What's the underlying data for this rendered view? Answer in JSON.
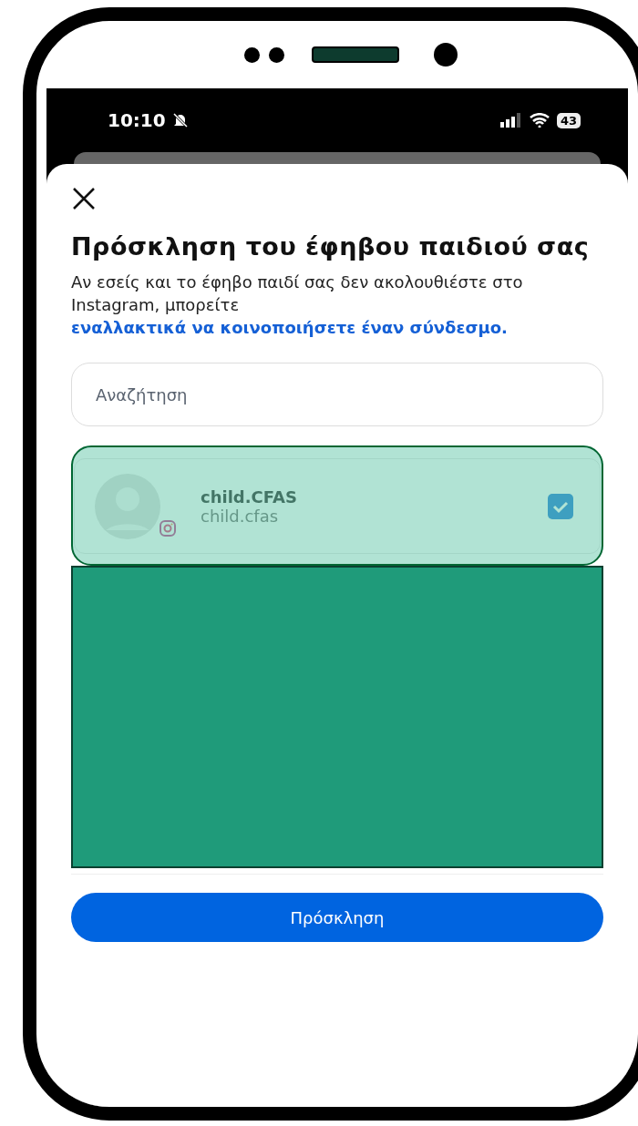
{
  "status_bar": {
    "time": "10:10",
    "battery": "43"
  },
  "sheet": {
    "title": "Πρόσκληση του έφηβου παιδιού σας",
    "description": "Αν εσείς και το έφηβο παιδί σας δεν ακολουθιέστε στο Instagram, μπορείτε ",
    "link": "εναλλακτικά να κοινοποιήσετε έναν σύνδεσμο."
  },
  "search": {
    "placeholder": "Αναζήτηση"
  },
  "accounts": [
    {
      "name": "child.CFAS",
      "username": "child.cfas",
      "selected": true
    }
  ],
  "button": "Πρόσκληση"
}
